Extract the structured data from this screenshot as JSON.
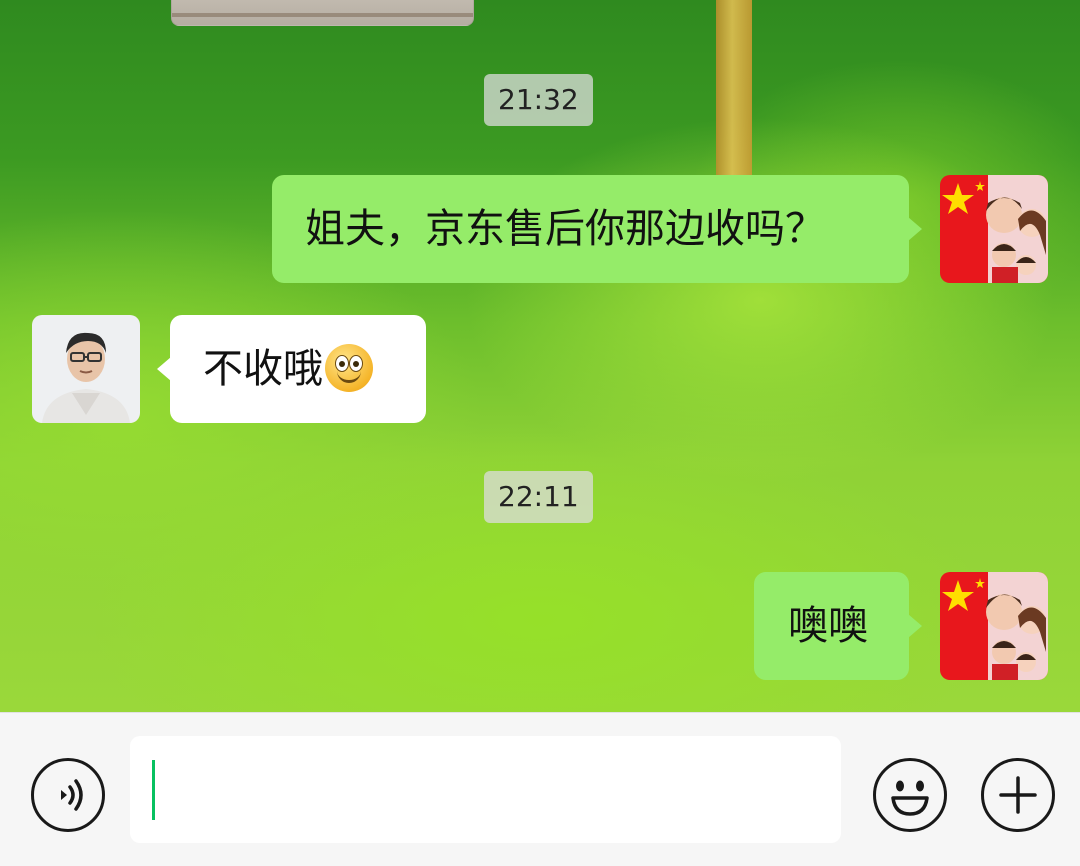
{
  "conversation": {
    "timestamps": [
      "21:32",
      "22:11"
    ],
    "messages": [
      {
        "sender": "me",
        "text": "姐夫，京东售后你那边收吗？"
      },
      {
        "sender": "other",
        "text": "不收哦",
        "emoji": "smile-emoji"
      },
      {
        "sender": "me",
        "text": "噢噢"
      }
    ]
  },
  "colors": {
    "my_bubble": "#95ec69",
    "their_bubble": "#ffffff",
    "cursor": "#07c160",
    "bar_bg": "#f6f6f6"
  },
  "input": {
    "value": "",
    "placeholder": ""
  },
  "icons": {
    "voice": "voice-icon",
    "emoji": "emoji-icon",
    "more": "plus-icon"
  }
}
